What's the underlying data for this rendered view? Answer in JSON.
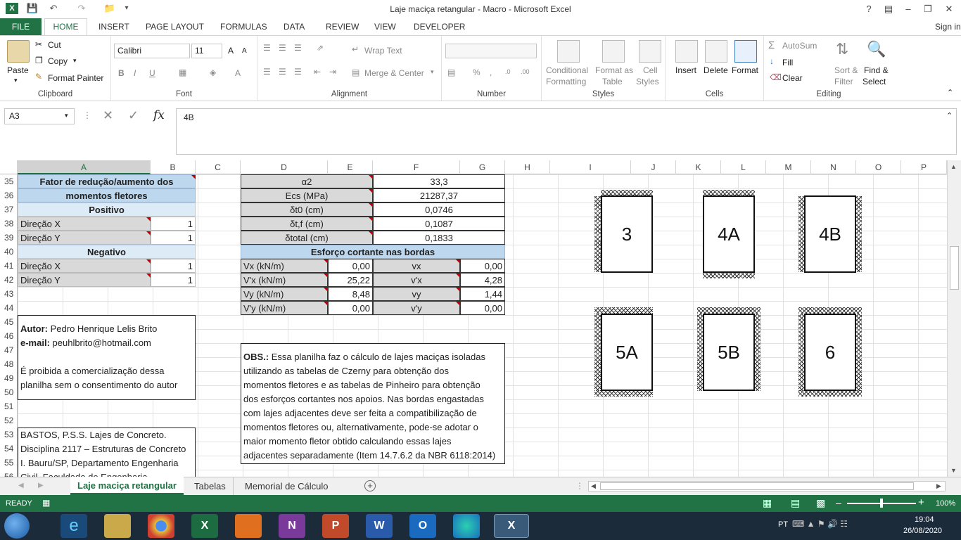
{
  "titlebar": {
    "title": "Laje maciça retangular - Macro - Microsoft Excel",
    "help": "?",
    "signin": "Sign in"
  },
  "tabs": {
    "file": "FILE",
    "home": "HOME",
    "insert": "INSERT",
    "page_layout": "PAGE LAYOUT",
    "formulas": "FORMULAS",
    "data": "DATA",
    "review": "REVIEW",
    "view": "VIEW",
    "developer": "DEVELOPER"
  },
  "ribbon": {
    "clipboard": {
      "label": "Clipboard",
      "paste": "Paste",
      "cut": "Cut",
      "copy": "Copy",
      "format_painter": "Format Painter"
    },
    "font": {
      "label": "Font",
      "name": "Calibri",
      "size": "11"
    },
    "alignment": {
      "label": "Alignment",
      "wrap": "Wrap Text",
      "merge": "Merge & Center"
    },
    "number": {
      "label": "Number"
    },
    "styles": {
      "label": "Styles",
      "cond1": "Conditional",
      "cond2": "Formatting",
      "fmt1": "Format as",
      "fmt2": "Table",
      "cell1": "Cell",
      "cell2": "Styles"
    },
    "cells": {
      "label": "Cells",
      "insert": "Insert",
      "delete": "Delete",
      "format": "Format"
    },
    "editing": {
      "label": "Editing",
      "autosum": "AutoSum",
      "fill": "Fill",
      "clear": "Clear",
      "sort1": "Sort &",
      "sort2": "Filter",
      "find1": "Find &",
      "find2": "Select"
    }
  },
  "formula": {
    "namebox": "A3",
    "content": "4B"
  },
  "columns": [
    "A",
    "B",
    "C",
    "D",
    "E",
    "F",
    "G",
    "H",
    "I",
    "J",
    "K",
    "L",
    "M",
    "N",
    "O",
    "P"
  ],
  "rows": [
    "35",
    "36",
    "37",
    "38",
    "39",
    "40",
    "41",
    "42",
    "43",
    "44",
    "45",
    "46",
    "47",
    "48",
    "49",
    "50",
    "51",
    "52",
    "53",
    "54",
    "55",
    "56"
  ],
  "left": {
    "title1": "Fator de redução/aumento dos",
    "title2": "momentos fletores",
    "positivo": "Positivo",
    "negativo": "Negativo",
    "dirx": "Direção X",
    "diry": "Direção Y",
    "one": "1",
    "autor_label": "Autor:",
    "autor": " Pedro Henrique Lelis Brito",
    "email_label": "e-mail:",
    "email": " peuhlbrito@hotmail.com",
    "proibida1": "É proibida a comercialização dessa",
    "proibida2": "planilha sem o consentimento do autor",
    "ref1": "BASTOS, P.S.S. Lajes de Concreto.",
    "ref2": "Disciplina 2117 – Estruturas de Concreto",
    "ref3": "I. Bauru/SP, Departamento Engenharia",
    "ref4": "Civil, Faculdade de Engenharia"
  },
  "mid": {
    "alpha2": "α2",
    "alpha2_v": "33,3",
    "ecs": "Ecs (MPa)",
    "ecs_v": "21287,37",
    "dt0": "δt0 (cm)",
    "dt0_v": "0,0746",
    "dtf": "δt,f (cm)",
    "dtf_v": "0,1087",
    "dtot": "δtotal (cm)",
    "dtot_v": "0,1833",
    "esforco": "Esforço cortante nas bordas",
    "vx": "Vx (kN/m)",
    "vx_v": "0,00",
    "vx2": "vx",
    "vx2_v": "0,00",
    "vpx": "V'x (kN/m)",
    "vpx_v": "25,22",
    "vpx2": "v'x",
    "vpx2_v": "4,28",
    "vy": "Vy (kN/m)",
    "vy_v": "8,48",
    "vy2": "vy",
    "vy2_v": "1,44",
    "vpy": "V'y (kN/m)",
    "vpy_v": "0,00",
    "vpy2": "v'y",
    "vpy2_v": "0,00",
    "obs_label": "OBS.:",
    "obs1": " Essa planilha faz o cálculo de lajes maciças isoladas",
    "obs2": "utilizando as tabelas de Czerny para obtenção dos",
    "obs3": "momentos fletores e as tabelas de Pinheiro para obtenção",
    "obs4": "dos esforços cortantes nos apoios. Nas bordas engastadas",
    "obs5": "com lajes adjacentes deve ser feita a compatibilização de",
    "obs6": "momentos fletores ou, alternativamente, pode-se adotar o",
    "obs7": "maior momento fletor obtido calculando essas lajes",
    "obs8": "adjacentes separadamente (Item 14.7.6.2 da NBR 6118:2014)"
  },
  "slabs": [
    "3",
    "4A",
    "4B",
    "5A",
    "5B",
    "6"
  ],
  "sheets": {
    "s1": "Laje maciça retangular",
    "s2": "Tabelas",
    "s3": "Memorial de Cálculo"
  },
  "status": {
    "ready": "READY",
    "zoom": "100%"
  },
  "taskbar": {
    "lang": "PT",
    "time": "19:04",
    "date": "26/08/2020"
  }
}
